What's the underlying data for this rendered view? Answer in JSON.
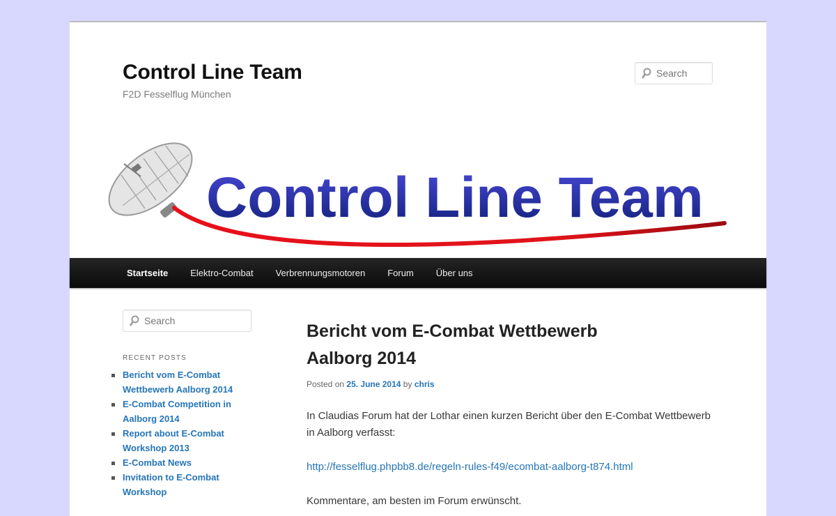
{
  "site": {
    "title": "Control Line Team",
    "description": "F2D Fesselflug München"
  },
  "header_search": {
    "placeholder": "Search"
  },
  "banner": {
    "text": "Control Line Team",
    "text_color": "#2a33a8",
    "line_color": "#e0141a"
  },
  "nav": {
    "items": [
      {
        "label": "Startseite",
        "current": true
      },
      {
        "label": "Elektro-Combat"
      },
      {
        "label": "Verbrennungsmotoren"
      },
      {
        "label": "Forum"
      },
      {
        "label": "Über uns"
      }
    ]
  },
  "sidebar": {
    "search_placeholder": "Search",
    "recent_posts_title": "RECENT POSTS",
    "recent_posts": [
      "Bericht vom E-Combat Wettbewerb Aalborg 2014",
      "E-Combat Competition in Aalborg 2014",
      "Report about E-Combat Workshop 2013",
      "E-Combat News",
      "Invitation to E-Combat Workshop"
    ]
  },
  "post": {
    "title": "Bericht vom E-Combat Wettbewerb Aalborg 2014",
    "posted_on_label": "Posted on",
    "date": "25. June 2014",
    "by_label": "by",
    "author": "chris",
    "paragraph1": "In Claudias Forum hat der Lothar einen kurzen Bericht über den E-Combat Wettbewerb in Aalborg verfasst:",
    "link": "http://fesselflug.phpbb8.de/regeln-rules-f49/ecombat-aalborg-t874.html",
    "paragraph3": "Kommentare, am besten im Forum erwünscht."
  },
  "colors": {
    "background": "#d8d8fe",
    "link": "#2575b8",
    "nav_bg": "#1a1a1a"
  }
}
